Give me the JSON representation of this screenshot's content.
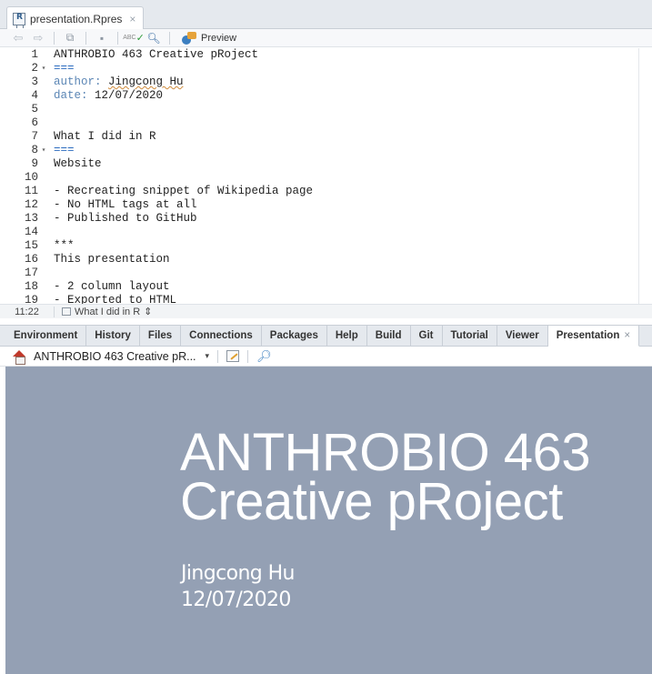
{
  "editor": {
    "tab": {
      "filename": "presentation.Rpres",
      "close_glyph": "×"
    },
    "toolbar": {
      "preview_label": "Preview",
      "spell_label": "ABC"
    },
    "lines": [
      {
        "n": "1",
        "fold": "",
        "text": "ANTHROBIO 463 Creative pRoject"
      },
      {
        "n": "2",
        "fold": "▾",
        "text": "==="
      },
      {
        "n": "3",
        "fold": "",
        "key": "author:",
        "value": "Jingcong Hu"
      },
      {
        "n": "4",
        "fold": "",
        "key": "date:",
        "value": " 12/07/2020"
      },
      {
        "n": "5",
        "fold": "",
        "text": ""
      },
      {
        "n": "6",
        "fold": "",
        "text": ""
      },
      {
        "n": "7",
        "fold": "",
        "text": "What I did in R"
      },
      {
        "n": "8",
        "fold": "▾",
        "text": "==="
      },
      {
        "n": "9",
        "fold": "",
        "text": "Website"
      },
      {
        "n": "10",
        "fold": "",
        "text": ""
      },
      {
        "n": "11",
        "fold": "",
        "text": "- Recreating snippet of Wikipedia page"
      },
      {
        "n": "12",
        "fold": "",
        "text": "- No HTML tags at all"
      },
      {
        "n": "13",
        "fold": "",
        "text": "- Published to GitHub"
      },
      {
        "n": "14",
        "fold": "",
        "text": ""
      },
      {
        "n": "15",
        "fold": "",
        "text": "***"
      },
      {
        "n": "16",
        "fold": "",
        "text": "This presentation"
      },
      {
        "n": "17",
        "fold": "",
        "text": ""
      },
      {
        "n": "18",
        "fold": "",
        "text": "- 2 column layout"
      },
      {
        "n": "19",
        "fold": "",
        "text": "- Exported to HTML"
      }
    ],
    "status": {
      "cursor": "11:22",
      "section": "What I did in R",
      "section_arrow": "⇕"
    }
  },
  "bottom_pane": {
    "tabs": [
      {
        "label": "Environment",
        "active": false
      },
      {
        "label": "History",
        "active": false
      },
      {
        "label": "Files",
        "active": false
      },
      {
        "label": "Connections",
        "active": false
      },
      {
        "label": "Packages",
        "active": false
      },
      {
        "label": "Help",
        "active": false
      },
      {
        "label": "Build",
        "active": false
      },
      {
        "label": "Git",
        "active": false
      },
      {
        "label": "Tutorial",
        "active": false
      },
      {
        "label": "Viewer",
        "active": false
      },
      {
        "label": "Presentation",
        "active": true
      }
    ],
    "close_glyph": "×",
    "slide_selector": "ANTHROBIO 463 Creative pR...",
    "slide": {
      "title_line1": "ANTHROBIO 463",
      "title_line2": "Creative pRoject",
      "author": "Jingcong Hu",
      "date": "12/07/2020",
      "background": "#94a0b4"
    }
  }
}
